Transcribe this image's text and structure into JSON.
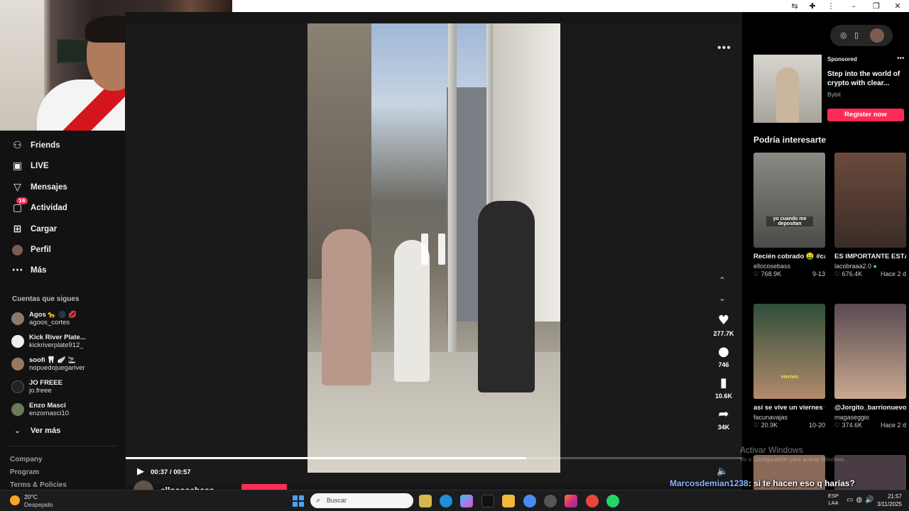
{
  "nav": {
    "items": [
      {
        "label": "Friends",
        "icon": "friends-icon",
        "glyph": "👥"
      },
      {
        "label": "LIVE",
        "icon": "live-icon",
        "glyph": "▣"
      },
      {
        "label": "Mensajes",
        "icon": "messages-icon",
        "glyph": "▽"
      },
      {
        "label": "Actividad",
        "icon": "activity-icon",
        "glyph": "▢",
        "badge": "16"
      },
      {
        "label": "Cargar",
        "icon": "upload-icon",
        "glyph": "⊞"
      },
      {
        "label": "Perfil",
        "icon": "profile-avatar",
        "glyph": ""
      },
      {
        "label": "Más",
        "icon": "more-icon",
        "glyph": "···"
      }
    ],
    "following_title": "Cuentas que sigues",
    "following": [
      {
        "name": "Agos 🐆 🌑 💋",
        "handle": "agoos_cortes"
      },
      {
        "name": "Kick River Plate...",
        "handle": "kickriverplate912_"
      },
      {
        "name": "soofi 🦷 🪽 🚬",
        "handle": "nopuedojuegariver"
      },
      {
        "name": "JO FREEE",
        "handle": "jo.freee"
      },
      {
        "name": "Enzo Masci",
        "handle": "enzomasci10"
      }
    ],
    "see_more": "Ver más",
    "footer": [
      "Company",
      "Program",
      "Terms & Policies"
    ]
  },
  "video": {
    "author": "ellocosebass",
    "time": "00:37 / 00:57",
    "progress": 0.65,
    "likes": "277.7K",
    "comments": "746",
    "saves": "10.6K",
    "shares": "34K"
  },
  "ad": {
    "label": "Sponsored",
    "title": "Step into the world of crypto with clear...",
    "brand": "Bybit",
    "cta": "Register now"
  },
  "recommendations": {
    "title": "Podría interesarte",
    "cards": [
      {
        "caption": "Recién cobrado 🤑 #calle #broma...",
        "author": "ellocosebass",
        "views": "768.9K",
        "date": "9-13",
        "overlay": "yo cuando me depositan",
        "color1": "#8c8a84",
        "color2": "#4b4a46"
      },
      {
        "caption": "ES IMPORTANTE ESTÁR NUTRIDO ...",
        "author": "lacobraaa2.0",
        "views": "676.4K",
        "date": "Hace 2 d",
        "overlay": "",
        "color1": "#6b4a3c",
        "color2": "#3a2c28"
      },
      {
        "caption": "así se vive un viernes en la barbería de...",
        "author": "facunavajas",
        "views": "20.9K",
        "date": "10-20",
        "overlay": "viernes",
        "color1": "#2f4f3a",
        "color2": "#b38a6c"
      },
      {
        "caption": "@Jorgito_barrionuevo 💘",
        "author": "magaseggio",
        "views": "374.6K",
        "date": "Hace 2 d",
        "overlay": "",
        "color1": "#5a4a52",
        "color2": "#c9a98f"
      }
    ]
  },
  "overlay": {
    "activate": "Activar Windows",
    "activate_sub": "Ve a Configuración para activar Windows.",
    "chat_user": "Marcosdemian1238",
    "chat_msg": ": si te hacen eso q harías?"
  },
  "taskbar": {
    "temp": "20°C",
    "weather": "Despejado",
    "search_placeholder": "Buscar",
    "lang1": "ESP",
    "lang2": "LAA",
    "time": "21:57",
    "date": "3/11/2025"
  }
}
